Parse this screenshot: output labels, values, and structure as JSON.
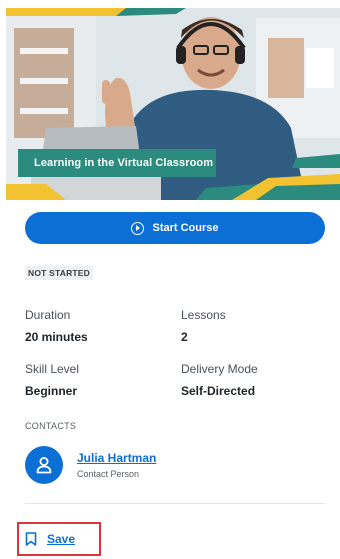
{
  "course": {
    "title": "Learning in the Virtual Classroom",
    "start_label": "Start Course",
    "status": "NOT STARTED"
  },
  "details": {
    "duration_label": "Duration",
    "duration_value": "20 minutes",
    "lessons_label": "Lessons",
    "lessons_value": "2",
    "skill_label": "Skill Level",
    "skill_value": "Beginner",
    "delivery_label": "Delivery Mode",
    "delivery_value": "Self-Directed"
  },
  "contacts": {
    "heading": "CONTACTS",
    "name": "Julia Hartman",
    "role": "Contact Person"
  },
  "actions": {
    "save_label": "Save"
  },
  "colors": {
    "accent": "#0b6fd6",
    "banner": "#2a8b7e",
    "highlight": "#d9363e"
  }
}
